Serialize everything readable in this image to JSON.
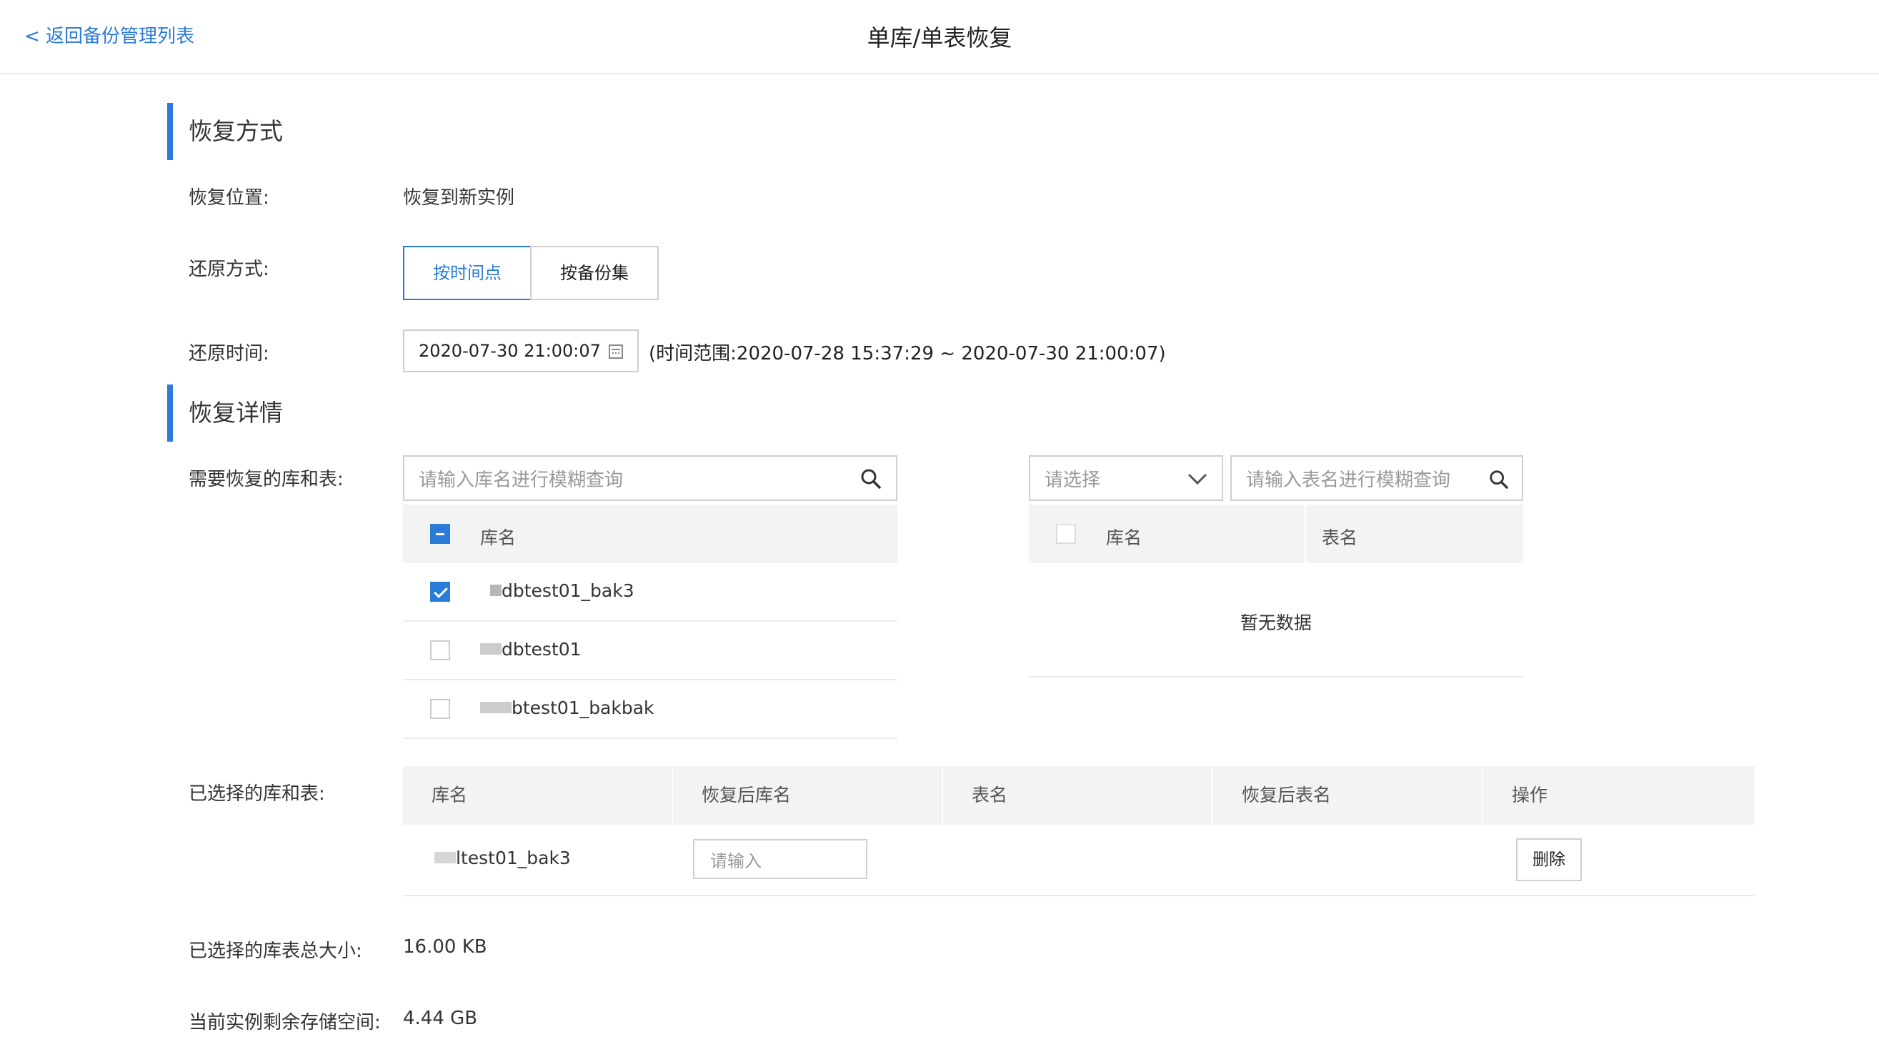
{
  "header": {
    "back_link": "< 返回备份管理列表",
    "title": "单库/单表恢复"
  },
  "section_method": {
    "title": "恢复方式",
    "location_label": "恢复位置:",
    "location_value": "恢复到新实例",
    "restore_mode_label": "还原方式:",
    "mode_options": [
      "按时间点",
      "按备份集"
    ],
    "active_mode": "按时间点",
    "restore_time_label": "还原时间:",
    "restore_time_value": "2020-07-30 21:00:07",
    "time_range": "(时间范围:2020-07-28 15:37:29 ~ 2020-07-30 21:00:07)"
  },
  "section_detail": {
    "title": "恢复详情",
    "need_restore_label": "需要恢复的库和表:",
    "db_search_placeholder": "请输入库名进行模糊查询",
    "db_table_header": "库名",
    "databases": [
      {
        "name": "dbtest01_bak3",
        "checked": true
      },
      {
        "name": "dbtest01",
        "checked": false
      },
      {
        "name": "btest01_bakbak",
        "checked": false
      }
    ],
    "table_select_placeholder": "请选择",
    "table_search_placeholder": "请输入表名进行模糊查询",
    "table_header_db": "库名",
    "table_header_table": "表名",
    "empty_text": "暂无数据",
    "selected_label": "已选择的库和表:",
    "selected_columns": [
      "库名",
      "恢复后库名",
      "表名",
      "恢复后表名",
      "操作"
    ],
    "selected_rows": [
      {
        "db": "ltest01_bak3",
        "new_db_placeholder": "请输入",
        "table": "",
        "new_table": "",
        "action": "删除"
      }
    ],
    "total_size_label": "已选择的库表总大小:",
    "total_size_value": "16.00 KB",
    "remaining_label": "当前实例剩余存储空间:",
    "remaining_value": "4.44 GB"
  },
  "colors": {
    "accent": "#2b7bd8",
    "border": "#cfcfcf",
    "header_bg": "#f3f3f3"
  }
}
